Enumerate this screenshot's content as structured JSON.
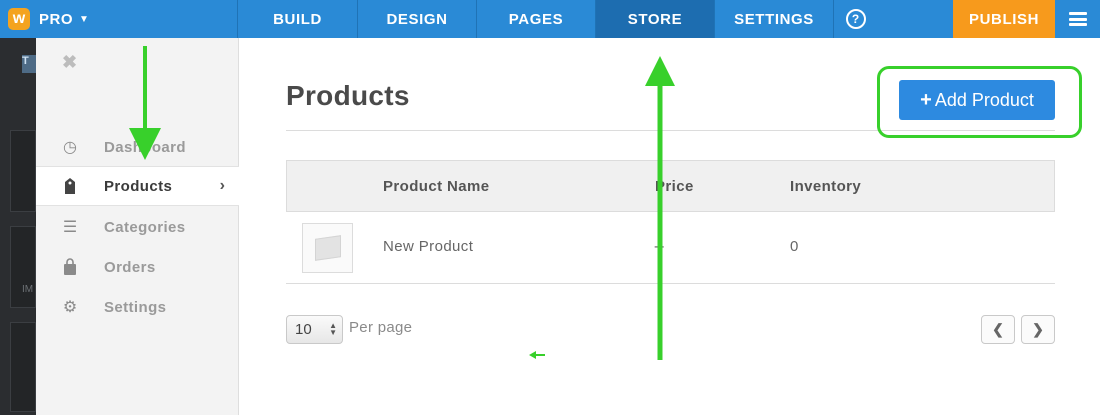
{
  "topbar": {
    "plan_label": "PRO",
    "tabs": [
      {
        "label": "BUILD",
        "active": false
      },
      {
        "label": "DESIGN",
        "active": false
      },
      {
        "label": "PAGES",
        "active": false
      },
      {
        "label": "STORE",
        "active": true
      },
      {
        "label": "SETTINGS",
        "active": false
      }
    ],
    "help_label": "?",
    "publish_label": "PUBLISH",
    "accent_color": "#2a8ad6",
    "publish_color": "#f79a1c"
  },
  "editor_bg": {
    "t_label": "T",
    "im_label": "IM"
  },
  "sidebar": {
    "items": [
      {
        "label": "Dashboard",
        "icon": "dashboard-gauge-icon",
        "active": false
      },
      {
        "label": "Products",
        "icon": "tag-icon",
        "active": true
      },
      {
        "label": "Categories",
        "icon": "list-icon",
        "active": false
      },
      {
        "label": "Orders",
        "icon": "shopping-bag-icon",
        "active": false
      },
      {
        "label": "Settings",
        "icon": "gear-icon",
        "active": false
      }
    ]
  },
  "main": {
    "title": "Products",
    "add_button_label": "Add Product",
    "table": {
      "columns": [
        "Product Name",
        "Price",
        "Inventory"
      ],
      "rows": [
        {
          "name": "New Product",
          "price": "--",
          "inventory": "0"
        }
      ]
    },
    "pagination": {
      "per_page_value": "10",
      "per_page_label": "Per page"
    }
  },
  "annotation_color": "#38d02b"
}
